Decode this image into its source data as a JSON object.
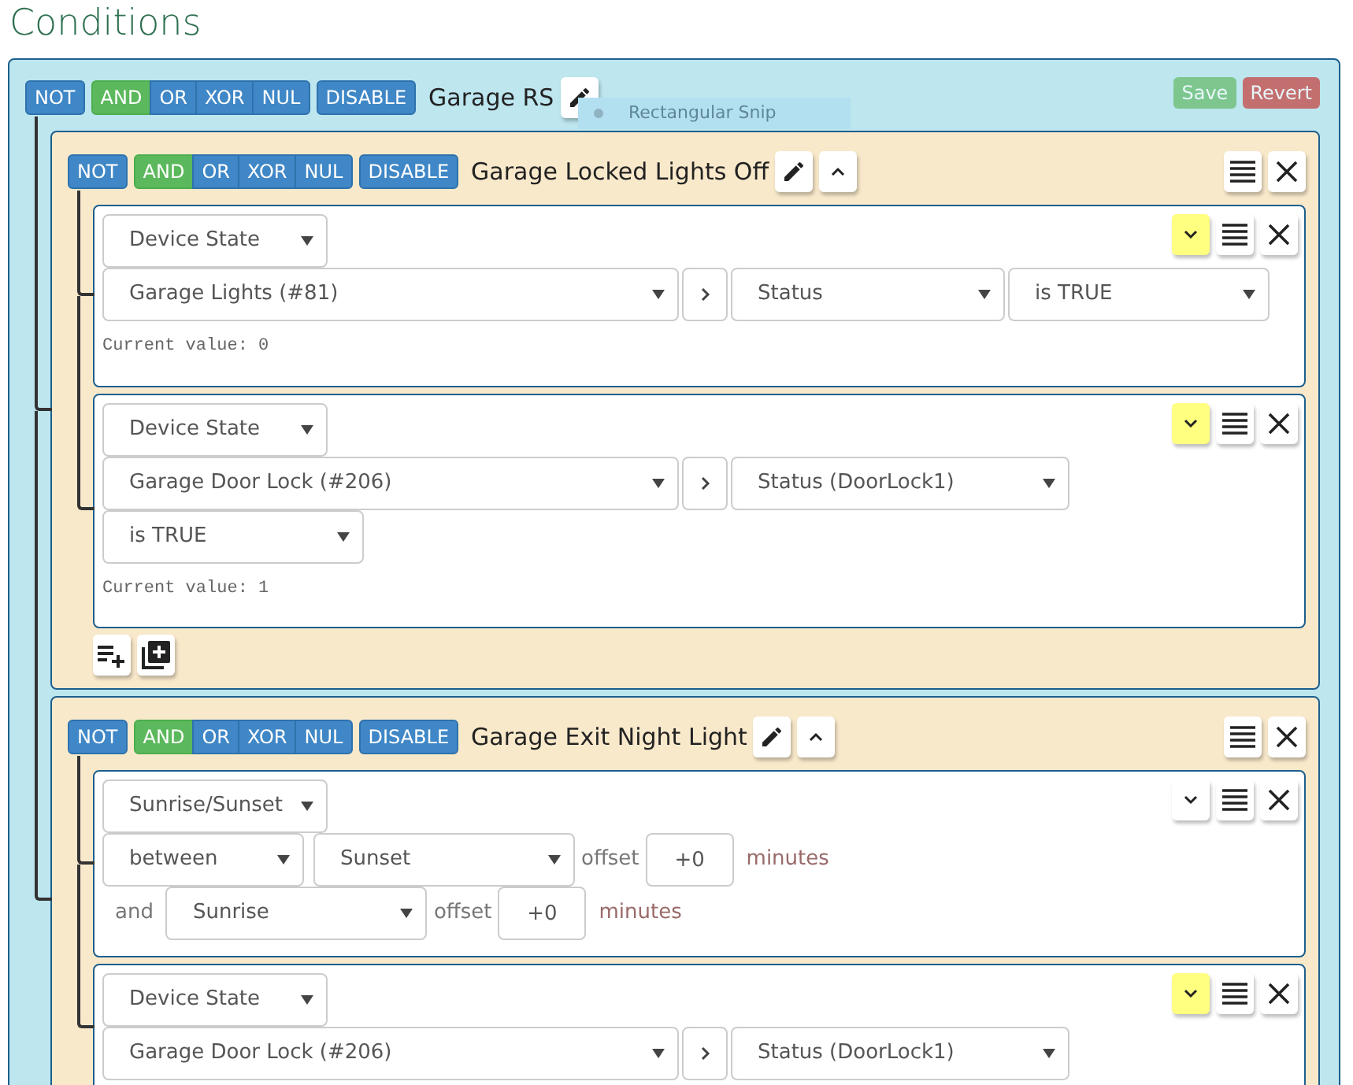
{
  "page_title": "Conditions",
  "snip_tooltip": {
    "text": "Rectangular Snip"
  },
  "root": {
    "operators": [
      {
        "label": "NOT",
        "kind": "toggle",
        "selected": false
      },
      {
        "label": "AND",
        "kind": "join",
        "selected": true
      },
      {
        "label": "OR",
        "kind": "join",
        "selected": false
      },
      {
        "label": "XOR",
        "kind": "join",
        "selected": false
      },
      {
        "label": "NUL",
        "kind": "join",
        "selected": false
      },
      {
        "label": "DISABLE",
        "kind": "toggle",
        "selected": false
      }
    ],
    "name": "Garage RS",
    "save": {
      "label": "Save",
      "disabled": true
    },
    "revert": {
      "label": "Revert",
      "disabled": true
    },
    "groups": [
      {
        "operators": [
          {
            "label": "NOT",
            "kind": "toggle",
            "selected": false
          },
          {
            "label": "AND",
            "kind": "join",
            "selected": true
          },
          {
            "label": "OR",
            "kind": "join",
            "selected": false
          },
          {
            "label": "XOR",
            "kind": "join",
            "selected": false
          },
          {
            "label": "NUL",
            "kind": "join",
            "selected": false
          },
          {
            "label": "DISABLE",
            "kind": "toggle",
            "selected": false
          }
        ],
        "name": "Garage Locked Lights Off",
        "add_buttons": true,
        "conditions": [
          {
            "kind": "device",
            "type": "Device State",
            "device": "Garage Lights (#81)",
            "attribute": "Status",
            "operator": "is TRUE",
            "current_value": "Current value: 0",
            "flagged": true
          },
          {
            "kind": "device",
            "type": "Device State",
            "device": "Garage Door Lock (#206)",
            "attribute": "Status (DoorLock1)",
            "operator": "is TRUE",
            "current_value": "Current value: 1",
            "flagged": true
          }
        ]
      },
      {
        "operators": [
          {
            "label": "NOT",
            "kind": "toggle",
            "selected": false
          },
          {
            "label": "AND",
            "kind": "join",
            "selected": true
          },
          {
            "label": "OR",
            "kind": "join",
            "selected": false
          },
          {
            "label": "XOR",
            "kind": "join",
            "selected": false
          },
          {
            "label": "NUL",
            "kind": "join",
            "selected": false
          },
          {
            "label": "DISABLE",
            "kind": "toggle",
            "selected": false
          }
        ],
        "name": "Garage Exit Night Light",
        "add_buttons": false,
        "conditions": [
          {
            "kind": "sun",
            "type": "Sunrise/Sunset",
            "mode": "between",
            "start": "Sunset",
            "start_offset_label": "offset",
            "start_offset": "+0",
            "start_unit": "minutes",
            "and_label": "and",
            "end": "Sunrise",
            "end_offset_label": "offset",
            "end_offset": "+0",
            "end_unit": "minutes",
            "flagged": false
          },
          {
            "kind": "device",
            "type": "Device State",
            "device": "Garage Door Lock (#206)",
            "attribute": "Status (DoorLock1)",
            "flagged": true
          }
        ]
      }
    ]
  }
}
